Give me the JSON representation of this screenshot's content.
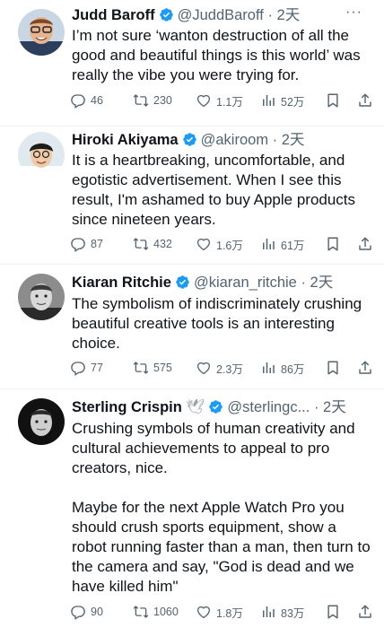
{
  "tweets": [
    {
      "name": "Judd Baroff",
      "handle": "@JuddBaroff",
      "time": "· 2天",
      "verified": "blue-check",
      "text": "I’m not sure ‘wanton destruction of all the good and beautiful things is this world’ was really the vibe you were trying for.",
      "replies": "46",
      "retweets": "230",
      "likes": "1.1万",
      "views": "52万"
    },
    {
      "name": "Hiroki Akiyama",
      "handle": "@akiroom",
      "time": "· 2天",
      "verified": "blue-check",
      "text": "It is a heartbreaking, uncomfortable, and egotistic advertisement. When I see this result, I'm ashamed to buy Apple products since nineteen years.",
      "replies": "87",
      "retweets": "432",
      "likes": "1.6万",
      "views": "61万"
    },
    {
      "name": "Kiaran Ritchie",
      "handle": "@kiaran_ritchie",
      "time": "· 2天",
      "verified": "blue-check",
      "text": "The symbolism of indiscriminately crushing beautiful creative tools is an interesting choice.",
      "replies": "77",
      "retweets": "575",
      "likes": "2.3万",
      "views": "86万"
    },
    {
      "name": "Sterling Crispin",
      "handle": "@sterlingc...",
      "time": "· 2天",
      "verified": "dove-emoji + blue-check",
      "text": "Crushing symbols of human creativity and cultural achievements to appeal to pro creators, nice.\n\nMaybe for the next Apple Watch Pro you should crush sports equipment, show a robot running faster than a man, then turn to the camera and say, \"God is dead and we have killed him\"",
      "replies": "90",
      "retweets": "1060",
      "likes": "1.8万",
      "views": "83万"
    }
  ],
  "more_label": "···",
  "dove_emoji": "🕊",
  "colors": {
    "text": "#0f1419",
    "secondary": "#536471",
    "verified": "#1d9bf0",
    "divider": "#eff3f4"
  }
}
